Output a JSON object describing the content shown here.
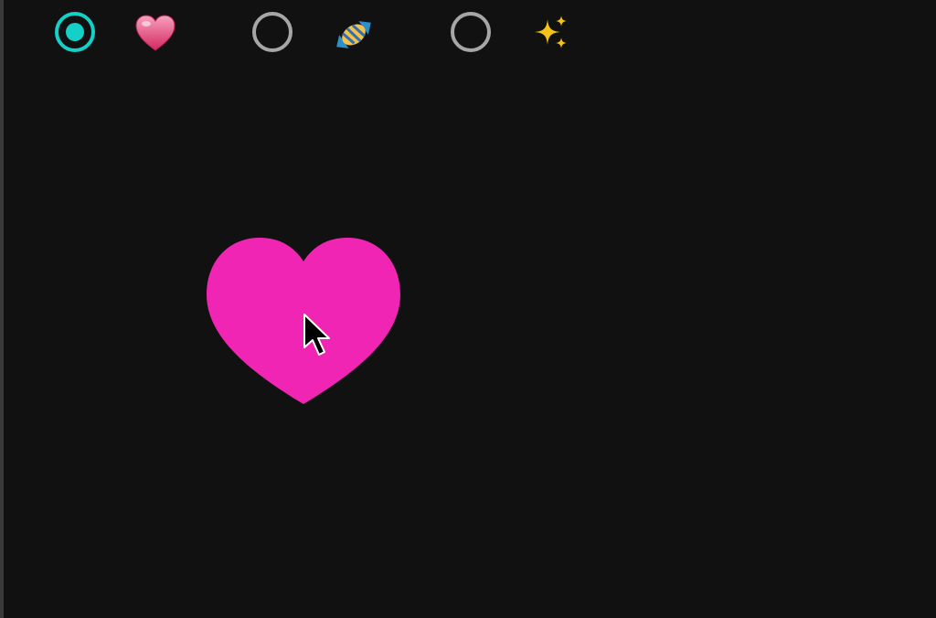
{
  "options": [
    {
      "id": "heart",
      "icon": "heart-emoji-icon",
      "selected": true
    },
    {
      "id": "candy",
      "icon": "candy-emoji-icon",
      "selected": false
    },
    {
      "id": "sparkles",
      "icon": "sparkles-emoji-icon",
      "selected": false
    }
  ],
  "colors": {
    "background": "#111111",
    "radio_selected": "#14d0c6",
    "radio_unselected": "#a6a6a6",
    "shape_fill": "#f025b3"
  },
  "canvas": {
    "shape": "heart-icon",
    "cursor": "mouse-pointer-icon"
  }
}
